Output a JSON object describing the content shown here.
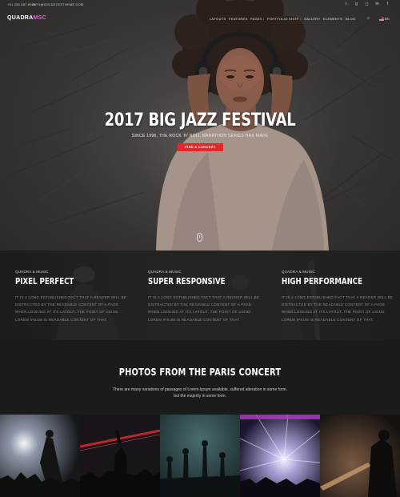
{
  "topbar": {
    "phone": "+91 254 687 8910",
    "email": "INFO@GOLDEYESTHEME.COM",
    "social_icons": [
      "twitter-icon",
      "google-plus-icon",
      "instagram-icon",
      "email-icon",
      "facebook-icon"
    ]
  },
  "header": {
    "logo_part1": "QUADRA",
    "logo_part2": "MSC",
    "logo_accent": "#d86acb",
    "menu": [
      "LAYOUTS",
      "FEATURES",
      "PAGES",
      "PORTFOLIO",
      "SHOP",
      "GALLERY",
      "ELEMENTS",
      "BLOG"
    ],
    "language": "En"
  },
  "hero": {
    "title": "2017 BIG JAZZ FESTIVAL",
    "subtitle": "SINCE 1998, THE ROCK 'N' ROLL MARATHON SERIES HAS MADE",
    "cta": "FIND A CONCERT",
    "cta_color": "#e5262a"
  },
  "features": [
    {
      "eyebrow": "QUADRA & MUSIC",
      "title": "PIXEL PERFECT",
      "body": "IT IS A LONG ESTABLISHED FACT THAT A READER WILL BE DISTRACTED BY THE READABLE CONTENT OF A PAGE WHEN LOOKING AT ITS LAYOUT. THE POINT OF USING LOREM IPSUM IS READABLE CONTENT OF THAT."
    },
    {
      "eyebrow": "QUADRA & MUSIC",
      "title": "SUPER RESPONSIVE",
      "body": "IT IS A LONG ESTABLISHED FACT THAT A READER WILL BE DISTRACTED BY THE READABLE CONTENT OF A PAGE WHEN LOOKING AT ITS LAYOUT. THE POINT OF USING LOREM IPSUM IS READABLE CONTENT OF THAT."
    },
    {
      "eyebrow": "QUADRA & MUSIC",
      "title": "HIGH PERFORMANCE",
      "body": "IT IS A LONG ESTABLISHED FACT THAT A READER WILL BE DISTRACTED BY THE READABLE CONTENT OF A PAGE WHEN LOOKING AT ITS LAYOUT. THE POINT OF USING LOREM IPSUM IS READABLE CONTENT OF THAT."
    }
  ],
  "photos": {
    "title": "PHOTOS FROM THE PARIS CONCERT",
    "desc_line1": "There are many variations of passages of Lorem Ipsum available, suffered alteration in some form.",
    "desc_line2": "but the majority in some form."
  }
}
